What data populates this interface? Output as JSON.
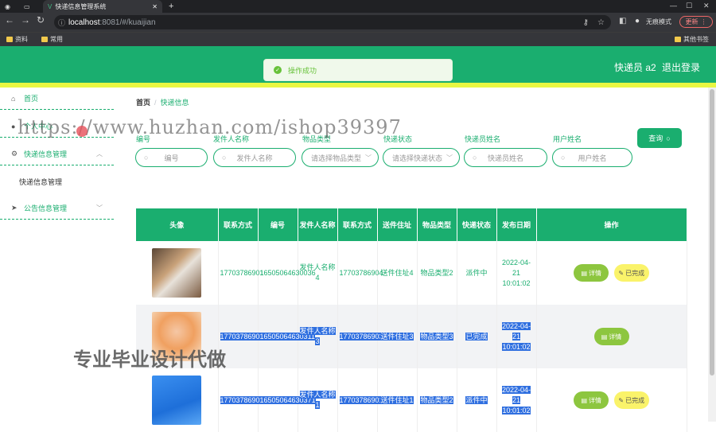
{
  "browser": {
    "tab_title": "快递信息管理系统",
    "url_host": "localhost",
    "url_path": ":8081/#/kuaijian",
    "incognito_label": "无痕模式",
    "update_label": "更新",
    "bookmarks": [
      "资料",
      "常用"
    ],
    "other_bookmarks": "其他书签"
  },
  "header": {
    "user_label": "快递员 a2",
    "logout_label": "退出登录"
  },
  "toast": {
    "message": "操作成功"
  },
  "sidebar": {
    "home": "首页",
    "personal": "个人中心",
    "express_group": "快递信息管理",
    "express_sub": "快递信息管理",
    "notice_group": "公告信息管理"
  },
  "breadcrumb": {
    "home": "首页",
    "sep": "/",
    "current": "快递信息"
  },
  "filters": [
    {
      "label": "编号",
      "placeholder": "编号"
    },
    {
      "label": "发件人名称",
      "placeholder": "发件人名称"
    },
    {
      "label": "物品类型",
      "placeholder": "请选择物品类型"
    },
    {
      "label": "快递状态",
      "placeholder": "请选择快递状态"
    },
    {
      "label": "快递员姓名",
      "placeholder": "快递员姓名"
    },
    {
      "label": "用户姓名",
      "placeholder": "用户姓名"
    }
  ],
  "query_label": "查询",
  "table": {
    "headers": [
      "头像",
      "联系方式",
      "编号",
      "发件人名称",
      "联系方式",
      "送件住址",
      "物品类型",
      "快递状态",
      "发布日期",
      "操作"
    ],
    "rows": [
      {
        "contact": "17703786901",
        "id": "16505064630036",
        "sender": "发件人名称4",
        "contact2": "17703786904",
        "address": "送件住址4",
        "type": "物品类型2",
        "status": "派件中",
        "date": "2022-04-21 10:01:02",
        "actions": [
          "详情",
          "已完成"
        ]
      },
      {
        "contact": "17703786903",
        "id": "16505064630311",
        "sender": "发件人名称3",
        "contact2": "17703786903",
        "address": "送件住址3",
        "type": "物品类型3",
        "status": "已完成",
        "date": "2022-04-21 10:01:02",
        "actions": [
          "详情"
        ]
      },
      {
        "contact": "17703786902",
        "id": "16505064630371",
        "sender": "发件人名称1",
        "contact2": "17703786901",
        "address": "送件住址1",
        "type": "物品类型2",
        "status": "派件中",
        "date": "2022-04-21 10:01:02",
        "actions": [
          "详情",
          "已完成"
        ]
      }
    ]
  },
  "watermark": {
    "url": "https://www.huzhan.com/ishop39397",
    "text": "专业毕业设计代做"
  },
  "colors": {
    "primary": "#1aae6f",
    "accent": "#e9f742",
    "detail_btn": "#8dc63f",
    "done_btn": "#faf36a"
  }
}
